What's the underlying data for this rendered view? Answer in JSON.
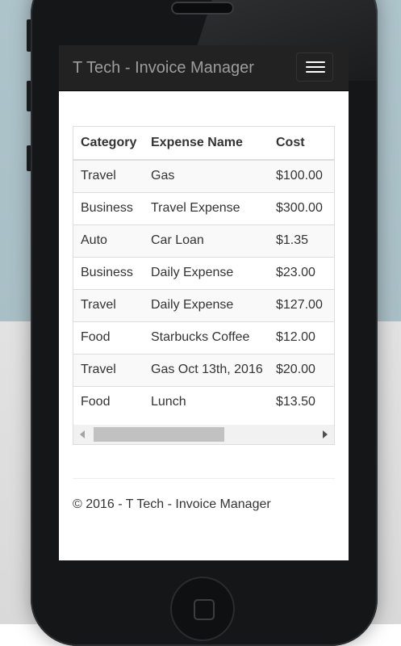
{
  "navbar": {
    "brand": "T Tech - Invoice Manager"
  },
  "table": {
    "headers": [
      "Category",
      "Expense Name",
      "Cost"
    ],
    "rows": [
      [
        "Travel",
        "Gas",
        "$100.00"
      ],
      [
        "Business",
        "Travel Expense",
        "$300.00"
      ],
      [
        "Auto",
        "Car Loan",
        "$1.35"
      ],
      [
        "Business",
        "Daily Expense",
        "$23.00"
      ],
      [
        "Travel",
        "Daily Expense",
        "$127.00"
      ],
      [
        "Food",
        "Starbucks Coffee",
        "$12.00"
      ],
      [
        "Travel",
        "Gas Oct 13th, 2016",
        "$20.00"
      ],
      [
        "Food",
        "Lunch",
        "$13.50"
      ]
    ]
  },
  "footer": {
    "text": "© 2016 - T Tech - Invoice Manager"
  },
  "colors": {
    "navbar_bg": "#222222",
    "brand_text": "#9d9d9d",
    "stripe": "#f9f9f9"
  },
  "icons": {
    "menu": "hamburger-icon"
  }
}
